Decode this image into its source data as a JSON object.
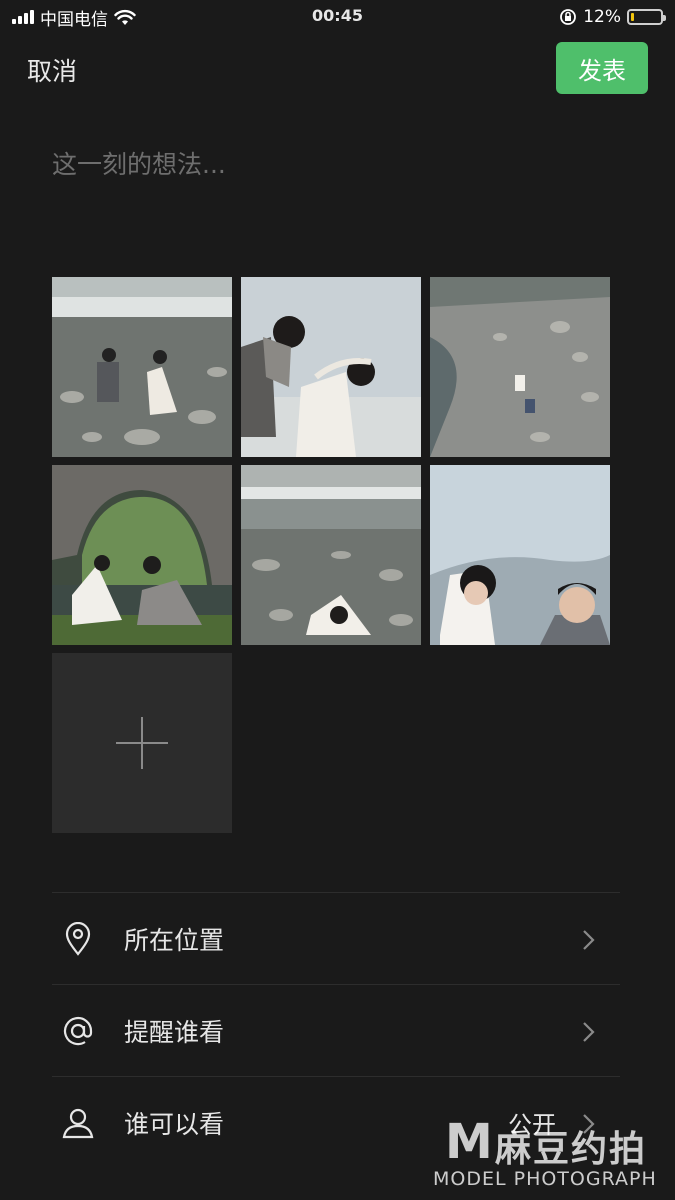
{
  "status_bar": {
    "carrier": "中国电信",
    "time": "00:45",
    "battery_percent": "12%",
    "battery_level": 0.12,
    "icons": [
      "signal-icon",
      "wifi-icon",
      "orientation-lock-icon",
      "battery-icon"
    ]
  },
  "nav": {
    "cancel_label": "取消",
    "publish_label": "发表"
  },
  "composer": {
    "placeholder": "这一刻的想法...",
    "value": ""
  },
  "photos": {
    "count": 6,
    "add_icon": "plus-icon"
  },
  "menu": [
    {
      "icon": "location-pin-icon",
      "label": "所在位置",
      "value": ""
    },
    {
      "icon": "at-icon",
      "label": "提醒谁看",
      "value": ""
    },
    {
      "icon": "person-icon",
      "label": "谁可以看",
      "value": "公开"
    }
  ],
  "watermark": {
    "logo_letter": "M",
    "brand_cn": "麻豆约拍",
    "brand_en": "MODEL PHOTOGRAPH"
  },
  "colors": {
    "background": "#1a1a1a",
    "accent": "#4fbf6b",
    "add_tile": "#2c2c2c"
  }
}
